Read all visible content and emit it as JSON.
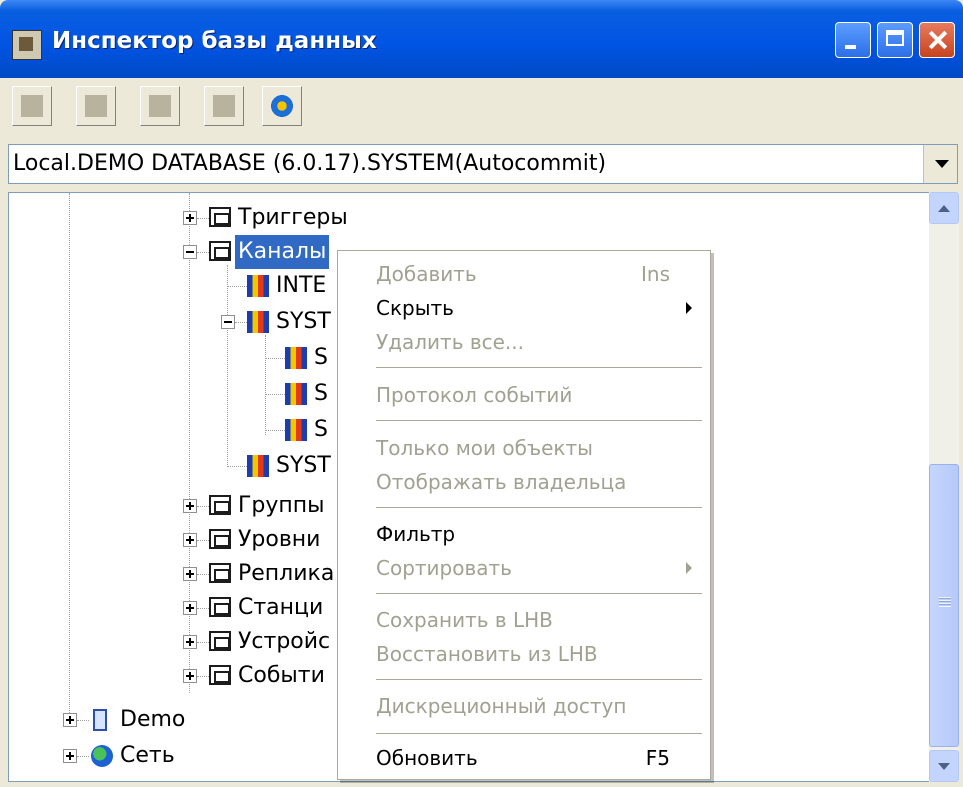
{
  "window": {
    "title": "Инспектор базы данных",
    "icon": "database-inspector-icon"
  },
  "toolbar": {
    "buttons": [
      "add-icon",
      "user-icon",
      "bell-icon",
      "window-icon",
      "refresh-globe-icon"
    ]
  },
  "connection": {
    "selected": "Local.DEMO DATABASE (6.0.17).SYSTEM(Autocommit)"
  },
  "tree": {
    "triggers": "Триггеры",
    "channels": "Каналы",
    "channel_inte": "INTE",
    "channel_syst1": "SYST",
    "child_s1": "S",
    "child_s2": "S",
    "child_s3": "S",
    "channel_syst2": "SYST",
    "groups": "Группы",
    "levels": "Уровни",
    "replicas": "Реплика",
    "stations": "Станци",
    "devices": "Устройс",
    "events": "Событи",
    "demo": "Demo",
    "network": "Сеть"
  },
  "context_menu": {
    "add": "Добавить",
    "add_shortcut": "Ins",
    "hide": "Скрыть",
    "delete_all": "Удалить все...",
    "event_log": "Протокол событий",
    "only_my_objects": "Только мои объекты",
    "show_owner": "Отображать владельца",
    "filter": "Фильтр",
    "sort": "Сортировать",
    "save_lhb": "Сохранить в LHB",
    "restore_lhb": "Восстановить из LHB",
    "discretionary_access": "Дискреционный доступ",
    "refresh": "Обновить",
    "refresh_shortcut": "F5"
  },
  "colors": {
    "title_bar": "#0054e3",
    "selection": "#316ac5",
    "disabled_text": "#a1a192"
  }
}
